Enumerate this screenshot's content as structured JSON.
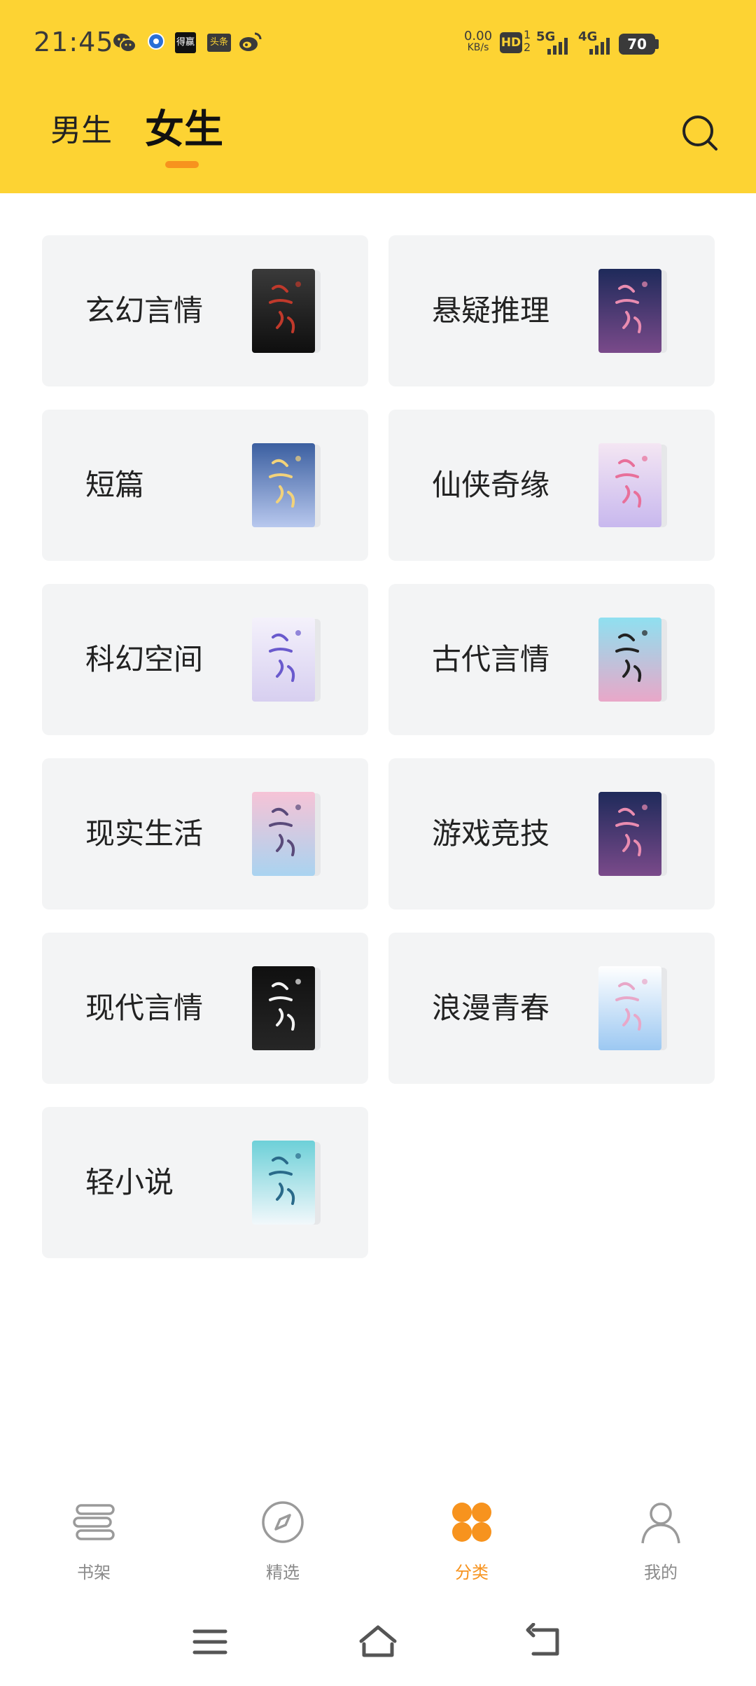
{
  "status_bar": {
    "time": "21:45",
    "net_speed_value": "0.00",
    "net_speed_unit": "KB/s",
    "hd_label": "HD",
    "sim1": "1",
    "sim2": "2",
    "signal1": "5G",
    "signal2": "4G",
    "battery": "70",
    "notif_badge_1": "得赢",
    "notif_badge_2": "头条"
  },
  "header": {
    "tab_male": "男生",
    "tab_female": "女生",
    "active_tab": "女生"
  },
  "categories": [
    {
      "label": "玄幻言情",
      "cover": "dark"
    },
    {
      "label": "悬疑推理",
      "cover": "night"
    },
    {
      "label": "短篇",
      "cover": "moon"
    },
    {
      "label": "仙侠奇缘",
      "cover": "pastel"
    },
    {
      "label": "科幻空间",
      "cover": "lavender"
    },
    {
      "label": "古代言情",
      "cover": "cyan"
    },
    {
      "label": "现实生活",
      "cover": "sakura"
    },
    {
      "label": "游戏竞技",
      "cover": "night"
    },
    {
      "label": "现代言情",
      "cover": "black"
    },
    {
      "label": "浪漫青春",
      "cover": "sky"
    },
    {
      "label": "轻小说",
      "cover": "teal"
    }
  ],
  "bottom_nav": [
    {
      "label": "书架",
      "icon": "bookshelf-icon",
      "active": false
    },
    {
      "label": "精选",
      "icon": "compass-icon",
      "active": false
    },
    {
      "label": "分类",
      "icon": "category-icon",
      "active": true
    },
    {
      "label": "我的",
      "icon": "profile-icon",
      "active": false
    }
  ],
  "colors": {
    "header_bg": "#FDD333",
    "accent": "#F7931E",
    "card_bg": "#F3F4F5",
    "nav_inactive": "#8a8a8a"
  }
}
